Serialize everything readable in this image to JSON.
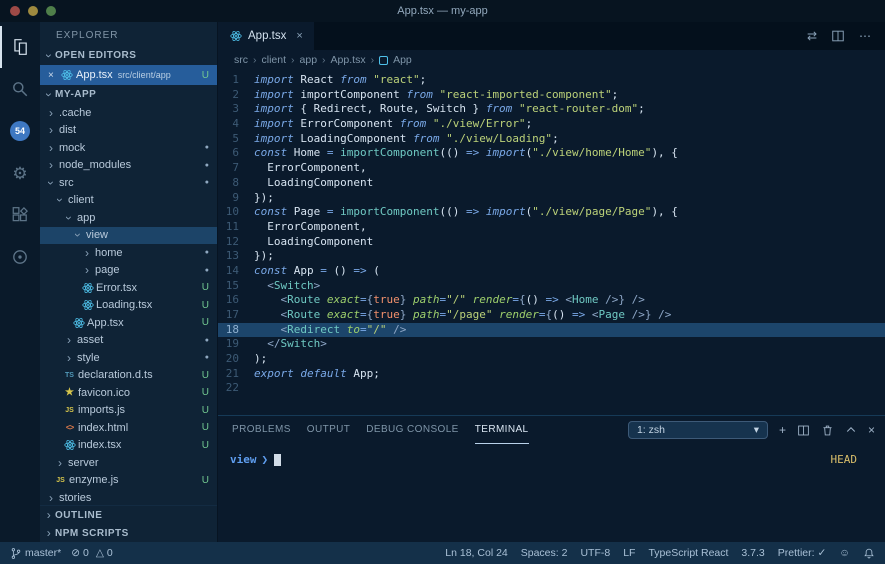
{
  "window": {
    "title": "App.tsx — my-app"
  },
  "icons": {
    "close": "×",
    "chevron": "›",
    "more": "⋯",
    "compare": "⇄",
    "gear": "⚙",
    "plus": "+",
    "select_caret": "▾",
    "error_circle": "⊘",
    "warning_triangle": "△",
    "smiley": "☺",
    "star": "★",
    "dot": "●",
    "prompt_symbol": "❯"
  },
  "activity_bar": {
    "scm_badge": "54"
  },
  "sidebar": {
    "title": "EXPLORER",
    "open_editors_label": "OPEN EDITORS",
    "project_label": "MY-APP",
    "outline_label": "OUTLINE",
    "npm_scripts_label": "NPM SCRIPTS",
    "open_editor": {
      "file": "App.tsx",
      "path": "src/client/app",
      "badge": "U"
    },
    "tree": [
      {
        "name": ".cache",
        "kind": "folder",
        "level": 1,
        "expanded": false
      },
      {
        "name": "dist",
        "kind": "folder",
        "level": 1,
        "expanded": false
      },
      {
        "name": "mock",
        "kind": "folder",
        "level": 1,
        "expanded": false,
        "dot": true
      },
      {
        "name": "node_modules",
        "kind": "folder",
        "level": 1,
        "expanded": false,
        "dot": true
      },
      {
        "name": "src",
        "kind": "folder",
        "level": 1,
        "expanded": true,
        "dot": true
      },
      {
        "name": "client",
        "kind": "folder",
        "level": 2,
        "expanded": true
      },
      {
        "name": "app",
        "kind": "folder",
        "level": 3,
        "expanded": true
      },
      {
        "name": "view",
        "kind": "folder",
        "level": 4,
        "expanded": true,
        "selected": true
      },
      {
        "name": "home",
        "kind": "folder",
        "level": 5,
        "expanded": false,
        "dot": true
      },
      {
        "name": "page",
        "kind": "folder",
        "level": 5,
        "expanded": false,
        "dot": true
      },
      {
        "name": "Error.tsx",
        "kind": "react",
        "level": 5,
        "badge": "U"
      },
      {
        "name": "Loading.tsx",
        "kind": "react",
        "level": 5,
        "badge": "U"
      },
      {
        "name": "App.tsx",
        "kind": "react",
        "level": 4,
        "badge": "U"
      },
      {
        "name": "asset",
        "kind": "folder",
        "level": 3,
        "expanded": false,
        "dot": true
      },
      {
        "name": "style",
        "kind": "folder",
        "level": 3,
        "expanded": false,
        "dot": true
      },
      {
        "name": "declaration.d.ts",
        "kind": "ts",
        "level": 3,
        "badge": "U"
      },
      {
        "name": "favicon.ico",
        "kind": "star",
        "level": 3,
        "badge": "U"
      },
      {
        "name": "imports.js",
        "kind": "js",
        "level": 3,
        "badge": "U"
      },
      {
        "name": "index.html",
        "kind": "html",
        "level": 3,
        "badge": "U"
      },
      {
        "name": "index.tsx",
        "kind": "react",
        "level": 3,
        "badge": "U"
      },
      {
        "name": "server",
        "kind": "folder",
        "level": 2,
        "expanded": false
      },
      {
        "name": "enzyme.js",
        "kind": "js",
        "level": 2,
        "badge": "U"
      },
      {
        "name": "stories",
        "kind": "folder",
        "level": 1,
        "expanded": false
      }
    ]
  },
  "editor": {
    "tab": {
      "label": "App.tsx"
    },
    "breadcrumbs": [
      "src",
      "client",
      "app",
      "App.tsx",
      "App"
    ],
    "code": {
      "active_line": 18,
      "lines": [
        [
          [
            "k",
            "import"
          ],
          [
            "p",
            " React "
          ],
          [
            "k",
            "from"
          ],
          [
            "p",
            " "
          ],
          [
            "s",
            "\"react\""
          ],
          [
            "p",
            ";"
          ]
        ],
        [
          [
            "k",
            "import"
          ],
          [
            "p",
            " importComponent "
          ],
          [
            "k",
            "from"
          ],
          [
            "p",
            " "
          ],
          [
            "s",
            "\"react-imported-component\""
          ],
          [
            "p",
            ";"
          ]
        ],
        [
          [
            "k",
            "import"
          ],
          [
            "p",
            " { Redirect, Route, Switch } "
          ],
          [
            "k",
            "from"
          ],
          [
            "p",
            " "
          ],
          [
            "s",
            "\"react-router-dom\""
          ],
          [
            "p",
            ";"
          ]
        ],
        [
          [
            "k",
            "import"
          ],
          [
            "p",
            " ErrorComponent "
          ],
          [
            "k",
            "from"
          ],
          [
            "p",
            " "
          ],
          [
            "s",
            "\"./view/Error\""
          ],
          [
            "p",
            ";"
          ]
        ],
        [
          [
            "k",
            "import"
          ],
          [
            "p",
            " LoadingComponent "
          ],
          [
            "k",
            "from"
          ],
          [
            "p",
            " "
          ],
          [
            "s",
            "\"./view/Loading\""
          ],
          [
            "p",
            ";"
          ]
        ],
        [
          [
            "k",
            "const"
          ],
          [
            "p",
            " Home "
          ],
          [
            "o",
            "="
          ],
          [
            "p",
            " "
          ],
          [
            "f",
            "importComponent"
          ],
          [
            "p",
            "(() "
          ],
          [
            "o",
            "=>"
          ],
          [
            "p",
            " "
          ],
          [
            "k",
            "import"
          ],
          [
            "p",
            "("
          ],
          [
            "s",
            "\"./view/home/Home\""
          ],
          [
            "p",
            "), {"
          ]
        ],
        [
          [
            "p",
            "  ErrorComponent,"
          ]
        ],
        [
          [
            "p",
            "  LoadingComponent"
          ]
        ],
        [
          [
            "p",
            "});"
          ]
        ],
        [
          [
            "k",
            "const"
          ],
          [
            "p",
            " Page "
          ],
          [
            "o",
            "="
          ],
          [
            "p",
            " "
          ],
          [
            "f",
            "importComponent"
          ],
          [
            "p",
            "(() "
          ],
          [
            "o",
            "=>"
          ],
          [
            "p",
            " "
          ],
          [
            "k",
            "import"
          ],
          [
            "p",
            "("
          ],
          [
            "s",
            "\"./view/page/Page\""
          ],
          [
            "p",
            "), {"
          ]
        ],
        [
          [
            "p",
            "  ErrorComponent,"
          ]
        ],
        [
          [
            "p",
            "  LoadingComponent"
          ]
        ],
        [
          [
            "p",
            "});"
          ]
        ],
        [
          [
            "k",
            "const"
          ],
          [
            "p",
            " App "
          ],
          [
            "o",
            "="
          ],
          [
            "p",
            " () "
          ],
          [
            "o",
            "=>"
          ],
          [
            "p",
            " ("
          ]
        ],
        [
          [
            "p",
            "  "
          ],
          [
            "d",
            "<"
          ],
          [
            "f",
            "Switch"
          ],
          [
            "d",
            ">"
          ]
        ],
        [
          [
            "p",
            "    "
          ],
          [
            "d",
            "<"
          ],
          [
            "f",
            "Route"
          ],
          [
            "p",
            " "
          ],
          [
            "a",
            "exact"
          ],
          [
            "o",
            "="
          ],
          [
            "d",
            "{"
          ],
          [
            "b",
            "true"
          ],
          [
            "d",
            "}"
          ],
          [
            "p",
            " "
          ],
          [
            "a",
            "path"
          ],
          [
            "o",
            "="
          ],
          [
            "s",
            "\"/\""
          ],
          [
            "p",
            " "
          ],
          [
            "a",
            "render"
          ],
          [
            "o",
            "="
          ],
          [
            "d",
            "{"
          ],
          [
            "p",
            "() "
          ],
          [
            "o",
            "=>"
          ],
          [
            "p",
            " "
          ],
          [
            "d",
            "<"
          ],
          [
            "f",
            "Home"
          ],
          [
            "p",
            " "
          ],
          [
            "d",
            "/>"
          ],
          [
            "d",
            "}"
          ],
          [
            "p",
            " "
          ],
          [
            "d",
            "/>"
          ]
        ],
        [
          [
            "p",
            "    "
          ],
          [
            "d",
            "<"
          ],
          [
            "f",
            "Route"
          ],
          [
            "p",
            " "
          ],
          [
            "a",
            "exact"
          ],
          [
            "o",
            "="
          ],
          [
            "d",
            "{"
          ],
          [
            "b",
            "true"
          ],
          [
            "d",
            "}"
          ],
          [
            "p",
            " "
          ],
          [
            "a",
            "path"
          ],
          [
            "o",
            "="
          ],
          [
            "s",
            "\"/page\""
          ],
          [
            "p",
            " "
          ],
          [
            "a",
            "render"
          ],
          [
            "o",
            "="
          ],
          [
            "d",
            "{"
          ],
          [
            "p",
            "() "
          ],
          [
            "o",
            "=>"
          ],
          [
            "p",
            " "
          ],
          [
            "d",
            "<"
          ],
          [
            "f",
            "Page"
          ],
          [
            "p",
            " "
          ],
          [
            "d",
            "/>"
          ],
          [
            "d",
            "}"
          ],
          [
            "p",
            " "
          ],
          [
            "d",
            "/>"
          ]
        ],
        [
          [
            "p",
            "    "
          ],
          [
            "d",
            "<"
          ],
          [
            "f",
            "Redirect"
          ],
          [
            "p",
            " "
          ],
          [
            "a",
            "to"
          ],
          [
            "o",
            "="
          ],
          [
            "s",
            "\"/\""
          ],
          [
            "p",
            " "
          ],
          [
            "d",
            "/>"
          ]
        ],
        [
          [
            "p",
            "  "
          ],
          [
            "d",
            "</"
          ],
          [
            "f",
            "Switch"
          ],
          [
            "d",
            ">"
          ]
        ],
        [
          [
            "p",
            ");"
          ]
        ],
        [
          [
            "k",
            "export"
          ],
          [
            "p",
            " "
          ],
          [
            "k",
            "default"
          ],
          [
            "p",
            " App;"
          ]
        ],
        []
      ]
    }
  },
  "panel": {
    "tabs": [
      "PROBLEMS",
      "OUTPUT",
      "DEBUG CONSOLE",
      "TERMINAL"
    ],
    "active_tab_index": 3,
    "shell_select": "1: zsh",
    "terminal": {
      "prompt_dir": "view",
      "right_status": "HEAD"
    }
  },
  "status_bar": {
    "branch": "master*",
    "errors": "0",
    "warnings": "0",
    "right_items": [
      "Ln 18, Col 24",
      "Spaces: 2",
      "UTF-8",
      "LF",
      "TypeScript React",
      "3.7.3",
      "Prettier: ✓"
    ]
  }
}
